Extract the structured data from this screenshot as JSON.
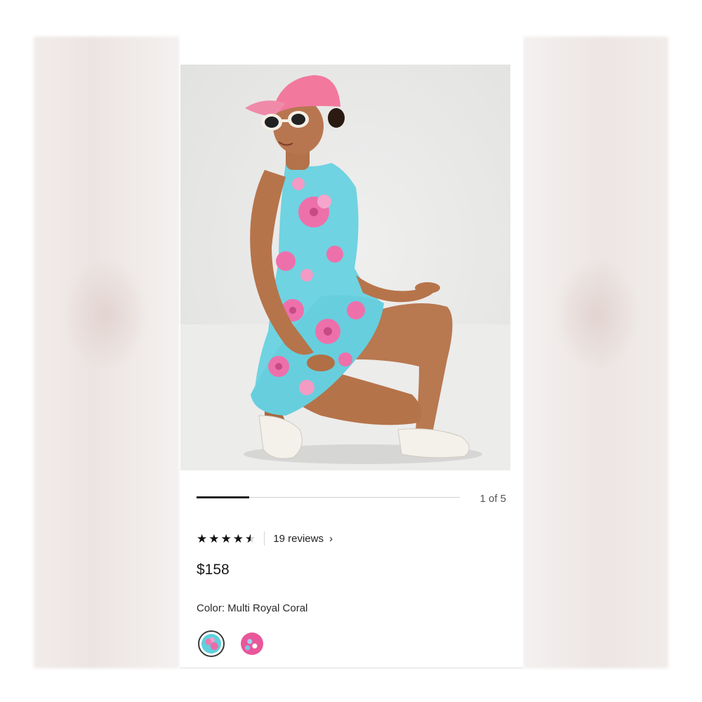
{
  "gallery": {
    "image_alt": "Model in Multi Royal Coral print dress crouching",
    "current_index": 1,
    "total": 5,
    "counter_text": "1 of 5",
    "progress_fraction": 0.2
  },
  "rating": {
    "value": 4.5,
    "max": 5,
    "reviews_text": "19 reviews",
    "chevron_icon": "chevron-right-icon"
  },
  "price": "$158",
  "color": {
    "label": "Color: Multi Royal Coral",
    "swatches": [
      {
        "name": "Multi Royal Coral",
        "selected": true,
        "colors": [
          "#5fd0de",
          "#ee6aa8"
        ]
      },
      {
        "name": "Pink print",
        "selected": false,
        "colors": [
          "#e9579a",
          "#9ad6f0"
        ]
      }
    ]
  },
  "colors": {
    "text": "#1f1f1f",
    "muted": "#555555",
    "star": "#111111"
  }
}
